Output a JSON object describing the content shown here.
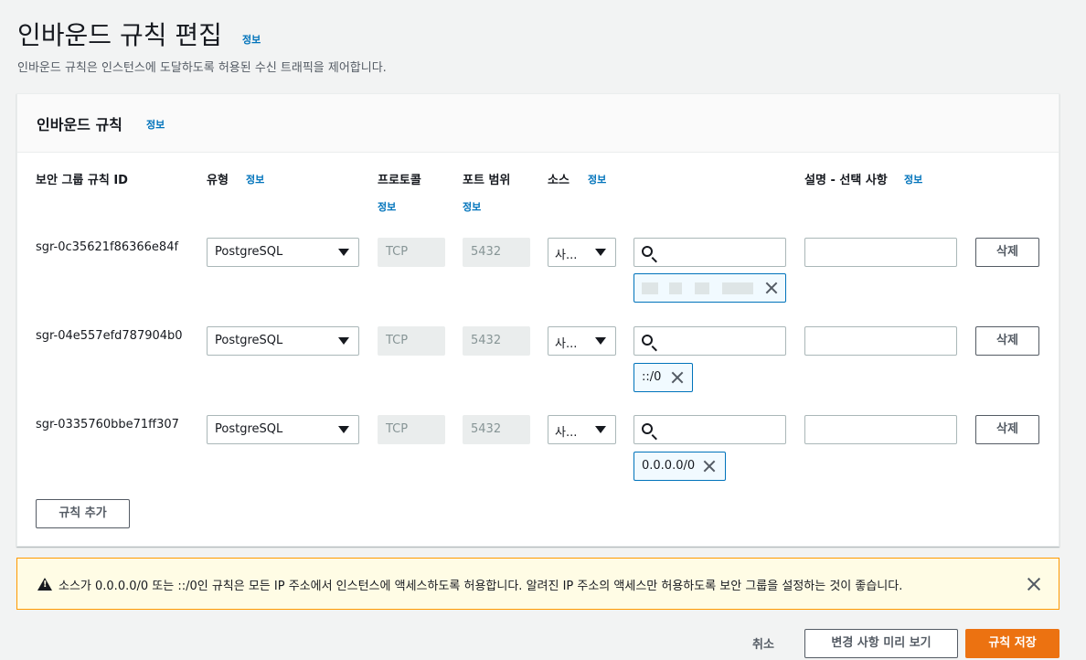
{
  "page": {
    "title": "인바운드 규칙 편집",
    "info": "정보",
    "description": "인바운드 규칙은 인스턴스에 도달하도록 허용된 수신 트래픽을 제어합니다."
  },
  "panel": {
    "title": "인바운드 규칙",
    "info": "정보"
  },
  "columns": {
    "rule_id": "보안 그룹 규칙 ID",
    "type": "유형",
    "type_info": "정보",
    "protocol": "프로토콜",
    "protocol_info": "정보",
    "port_range": "포트 범위",
    "port_info": "정보",
    "source": "소스",
    "source_info": "정보",
    "description": "설명 - 선택 사항",
    "description_info": "정보"
  },
  "rules": [
    {
      "id": "sgr-0c35621f86366e84f",
      "type": "PostgreSQL",
      "protocol": "TCP",
      "port": "5432",
      "source_type": "사...",
      "cidr": ""
    },
    {
      "id": "sgr-04e557efd787904b0",
      "type": "PostgreSQL",
      "protocol": "TCP",
      "port": "5432",
      "source_type": "사...",
      "cidr": "::/0"
    },
    {
      "id": "sgr-0335760bbe71ff307",
      "type": "PostgreSQL",
      "protocol": "TCP",
      "port": "5432",
      "source_type": "사...",
      "cidr": "0.0.0.0/0"
    }
  ],
  "buttons": {
    "delete": "삭제",
    "add_rule": "규칙 추가",
    "cancel": "취소",
    "preview": "변경 사항 미리 보기",
    "save": "규칙 저장"
  },
  "warning": {
    "text": "소스가 0.0.0.0/0 또는 ::/0인 규칙은 모든 IP 주소에서 인스턴스에 액세스하도록 허용합니다. 알려진 IP 주소의 액세스만 허용하도록 보안 그룹을 설정하는 것이 좋습니다."
  },
  "colors": {
    "link": "#0073bb",
    "primary": "#ec7211",
    "warning_border": "#ff9900",
    "warning_bg": "#fffce5"
  }
}
